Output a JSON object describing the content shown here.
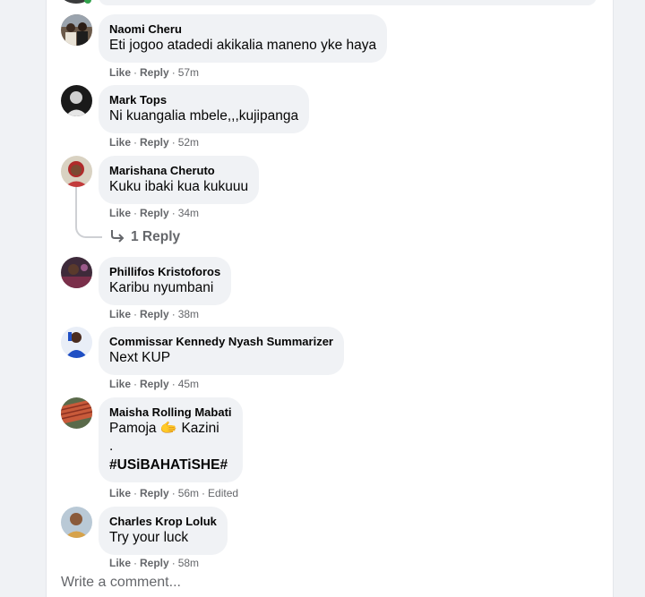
{
  "comments": [
    {
      "author": "Naomi Cheru",
      "text": "Eti jogoo atadedi akikalia maneno yke haya",
      "time": "57m"
    },
    {
      "author": "Mark Tops",
      "text": "Ni kuangalia mbele,,,kujipanga",
      "time": "52m"
    },
    {
      "author": "Marishana Cheruto",
      "text": "Kuku ibaki kua kukuuu",
      "time": "34m",
      "replies_label": "1 Reply"
    },
    {
      "author": "Phillifos Kristoforos",
      "text": "Karibu nyumbani",
      "time": "38m"
    },
    {
      "author": "Commissar Kennedy Nyash Summarizer",
      "text": "Next KUP",
      "time": "45m"
    },
    {
      "author": "Maisha Rolling Mabati",
      "text_lines": [
        "Pamoja 🫱 Kazini",
        ".",
        "#USiBAHATiSHE#"
      ],
      "time": "56m",
      "edited": "Edited"
    },
    {
      "author": "Charles Krop Loluk",
      "text": "Try your luck",
      "time": "58m"
    }
  ],
  "actions": {
    "like": "Like",
    "reply": "Reply",
    "separator": "·"
  },
  "composer": {
    "placeholder": "Write a comment..."
  },
  "colors": {
    "bubble": "#f0f2f5",
    "secondary_text": "#65676b",
    "online": "#31a24c"
  }
}
